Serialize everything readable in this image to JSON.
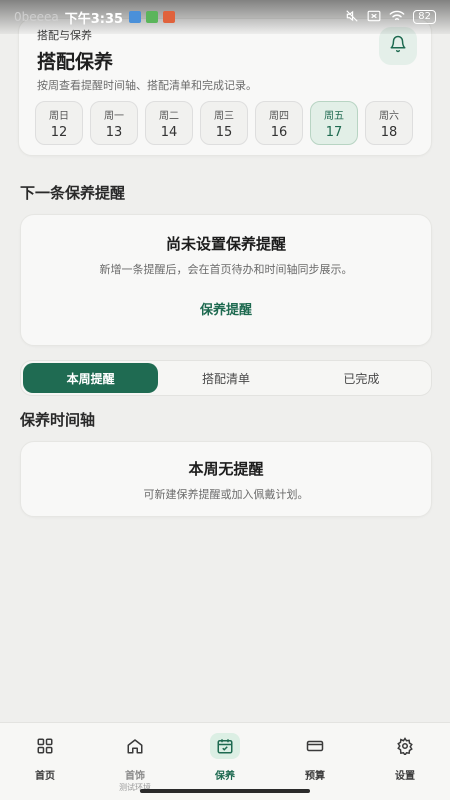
{
  "status_bar": {
    "ghost_text": "0beeea",
    "time": "下午3:35",
    "battery": "82"
  },
  "top_card": {
    "eyebrow": "搭配与保养",
    "title": "搭配保养",
    "description": "按周查看提醒时间轴、搭配清单和完成记录。",
    "icon": "bell-icon",
    "week": [
      {
        "weekday": "周日",
        "date": "12",
        "active": false
      },
      {
        "weekday": "周一",
        "date": "13",
        "active": false
      },
      {
        "weekday": "周二",
        "date": "14",
        "active": false
      },
      {
        "weekday": "周三",
        "date": "15",
        "active": false
      },
      {
        "weekday": "周四",
        "date": "16",
        "active": false
      },
      {
        "weekday": "周五",
        "date": "17",
        "active": true
      },
      {
        "weekday": "周六",
        "date": "18",
        "active": false
      }
    ]
  },
  "next_reminder": {
    "section_title": "下一条保养提醒",
    "empty_title": "尚未设置保养提醒",
    "empty_desc": "新增一条提醒后，会在首页待办和时间轴同步展示。",
    "action_label": "保养提醒"
  },
  "tabs": {
    "items": [
      "本周提醒",
      "搭配清单",
      "已完成"
    ],
    "active_index": 0
  },
  "timeline": {
    "section_title": "保养时间轴",
    "empty_title": "本周无提醒",
    "empty_desc": "可新建保养提醒或加入佩戴计划。"
  },
  "bottom_nav": {
    "items": [
      {
        "label": "首页",
        "icon": "grid-icon",
        "active": false
      },
      {
        "label": "首饰",
        "sub": "测试环境",
        "icon": "house-icon",
        "active": false
      },
      {
        "label": "保养",
        "icon": "calendar-icon",
        "active": true
      },
      {
        "label": "预算",
        "icon": "card-icon",
        "active": false
      },
      {
        "label": "设置",
        "icon": "gear-icon",
        "active": false
      }
    ]
  },
  "colors": {
    "accent": "#1f6b52",
    "background": "#efefed",
    "card": "#f8f8f7"
  }
}
